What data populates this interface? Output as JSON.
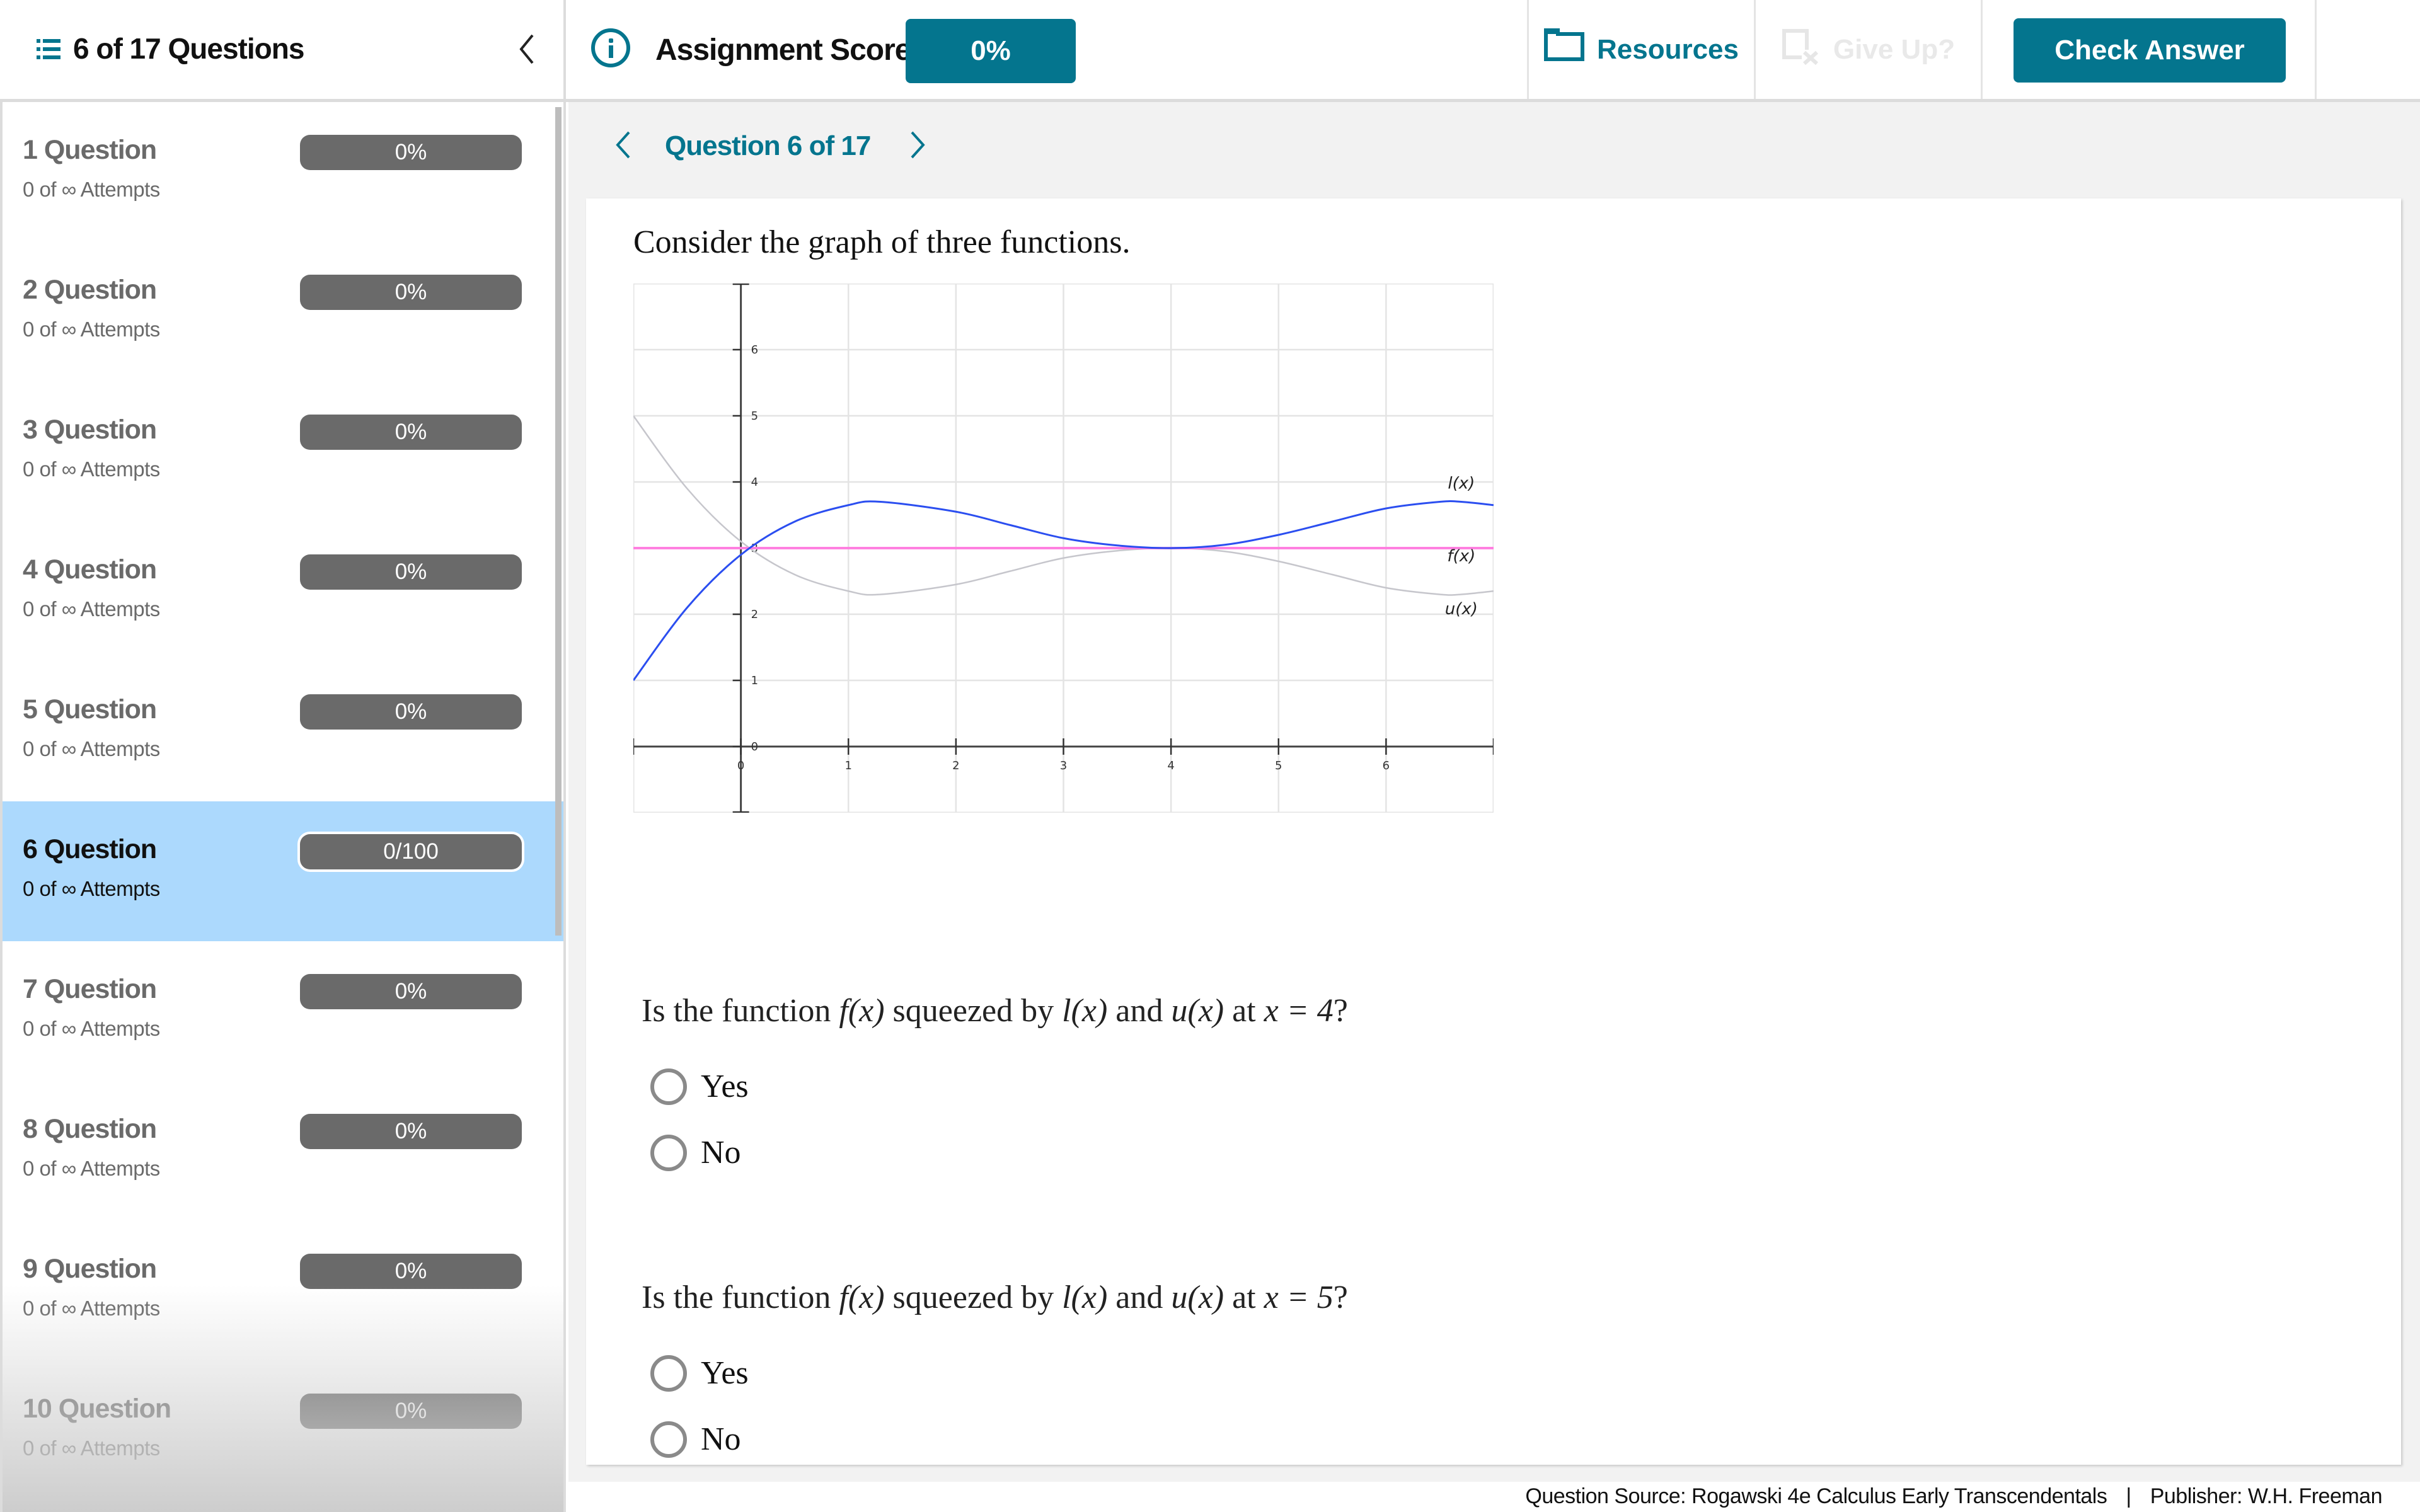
{
  "header": {
    "progress_title": "6 of 17 Questions",
    "list_icon": "list-icon",
    "collapse_icon": "chevron-left-icon",
    "info_icon": "info-icon",
    "score_label": "Assignment Score:",
    "score_value": "0%",
    "resources_label": "Resources",
    "resources_icon": "folder-icon",
    "give_up_label": "Give Up?",
    "give_up_icon": "give-up-icon",
    "give_up_disabled": true,
    "check_answer_label": "Check Answer",
    "accent_color": "#04758e"
  },
  "sidebar": {
    "items": [
      {
        "label": "1 Question",
        "attempts": "0 of ∞ Attempts",
        "score": "0%",
        "active": false
      },
      {
        "label": "2 Question",
        "attempts": "0 of ∞ Attempts",
        "score": "0%",
        "active": false
      },
      {
        "label": "3 Question",
        "attempts": "0 of ∞ Attempts",
        "score": "0%",
        "active": false
      },
      {
        "label": "4 Question",
        "attempts": "0 of ∞ Attempts",
        "score": "0%",
        "active": false
      },
      {
        "label": "5 Question",
        "attempts": "0 of ∞ Attempts",
        "score": "0%",
        "active": false
      },
      {
        "label": "6 Question",
        "attempts": "0 of ∞ Attempts",
        "score": "0/100",
        "active": true
      },
      {
        "label": "7 Question",
        "attempts": "0 of ∞ Attempts",
        "score": "0%",
        "active": false
      },
      {
        "label": "8 Question",
        "attempts": "0 of ∞ Attempts",
        "score": "0%",
        "active": false
      },
      {
        "label": "9 Question",
        "attempts": "0 of ∞ Attempts",
        "score": "0%",
        "active": false
      },
      {
        "label": "10 Question",
        "attempts": "0 of ∞ Attempts",
        "score": "0%",
        "active": false
      }
    ],
    "active_color": "#acd9fd"
  },
  "question_nav": {
    "label": "Question 6 of 17",
    "prev_icon": "chevron-left-icon",
    "next_icon": "chevron-right-icon"
  },
  "question": {
    "intro": "Consider the graph of three functions.",
    "parts": [
      {
        "text_before": "Is the function ",
        "f": "f(x)",
        "mid1": " squeezed by ",
        "l": "l(x)",
        "mid2": " and ",
        "u": "u(x)",
        "mid3": " at ",
        "cond": "x = 4",
        "end": "?",
        "options": [
          "Yes",
          "No"
        ],
        "selected": null
      },
      {
        "text_before": "Is the function ",
        "f": "f(x)",
        "mid1": " squeezed by ",
        "l": "l(x)",
        "mid2": " and ",
        "u": "u(x)",
        "mid3": " at ",
        "cond": "x = 5",
        "end": "?",
        "options": [
          "Yes",
          "No"
        ],
        "selected": null
      }
    ]
  },
  "chart_data": {
    "type": "line",
    "title": "",
    "xlabel": "",
    "ylabel": "",
    "xlim": [
      -1,
      7
    ],
    "ylim": [
      -1,
      7
    ],
    "grid": true,
    "x_ticks": [
      0,
      1,
      2,
      3,
      4,
      5,
      6
    ],
    "y_ticks": [
      0,
      1,
      2,
      3,
      4,
      5,
      6
    ],
    "series": [
      {
        "name": "l(x)",
        "color": "#2b4ef0",
        "x": [
          -1,
          -0.5,
          0,
          0.5,
          1,
          1.3,
          2,
          2.5,
          3,
          3.5,
          4,
          4.5,
          5,
          5.5,
          6,
          6.5,
          6.7,
          7
        ],
        "y": [
          1.0,
          2.1,
          2.9,
          3.4,
          3.65,
          3.7,
          3.55,
          3.35,
          3.15,
          3.04,
          3.0,
          3.05,
          3.2,
          3.4,
          3.6,
          3.7,
          3.7,
          3.65
        ]
      },
      {
        "name": "f(x)",
        "color": "#ff80e0",
        "x": [
          -1,
          7
        ],
        "y": [
          3,
          3
        ]
      },
      {
        "name": "u(x)",
        "color": "#c6c6cc",
        "x": [
          -1,
          -0.5,
          0,
          0.5,
          1,
          1.3,
          2,
          2.5,
          3,
          3.5,
          4,
          4.5,
          5,
          5.5,
          6,
          6.5,
          6.7,
          7
        ],
        "y": [
          5.0,
          3.9,
          3.1,
          2.6,
          2.35,
          2.3,
          2.45,
          2.65,
          2.85,
          2.96,
          3.0,
          2.95,
          2.8,
          2.6,
          2.4,
          2.3,
          2.3,
          2.35
        ]
      }
    ],
    "annotations": [
      {
        "text": "l(x)",
        "x": 6.7,
        "y": 3.9
      },
      {
        "text": "f(x)",
        "x": 6.7,
        "y": 2.8
      },
      {
        "text": "u(x)",
        "x": 6.7,
        "y": 2.0
      }
    ]
  },
  "footer": {
    "source": "Question Source: Rogawski 4e Calculus Early Transcendentals",
    "separator": "|",
    "publisher": "Publisher: W.H. Freeman"
  }
}
